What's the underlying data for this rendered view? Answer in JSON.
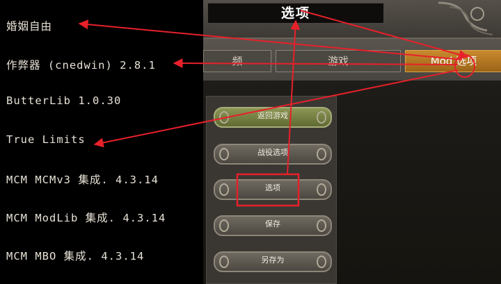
{
  "mod_list": {
    "items": [
      "婚姻自由",
      "作弊器 (cnedwin) 2.8.1",
      "ButterLib 1.0.30",
      "True Limits",
      "MCM MCMv3 集成. 4.3.14",
      "MCM ModLib 集成. 4.3.14",
      "MCM MBO 集成. 4.3.14"
    ]
  },
  "header": {
    "title": "选项"
  },
  "tabs": [
    {
      "label": "频"
    },
    {
      "label": "游戏"
    },
    {
      "label": "Mod 选项"
    }
  ],
  "menu": {
    "buttons": [
      {
        "label": "返回游戏"
      },
      {
        "label": "战役选项"
      },
      {
        "label": "选项"
      },
      {
        "label": "保存"
      },
      {
        "label": "另存为"
      }
    ]
  },
  "colors": {
    "annotation": "#e8202a",
    "active_tab": "#c98a2e",
    "return_button": "#8c9654"
  }
}
